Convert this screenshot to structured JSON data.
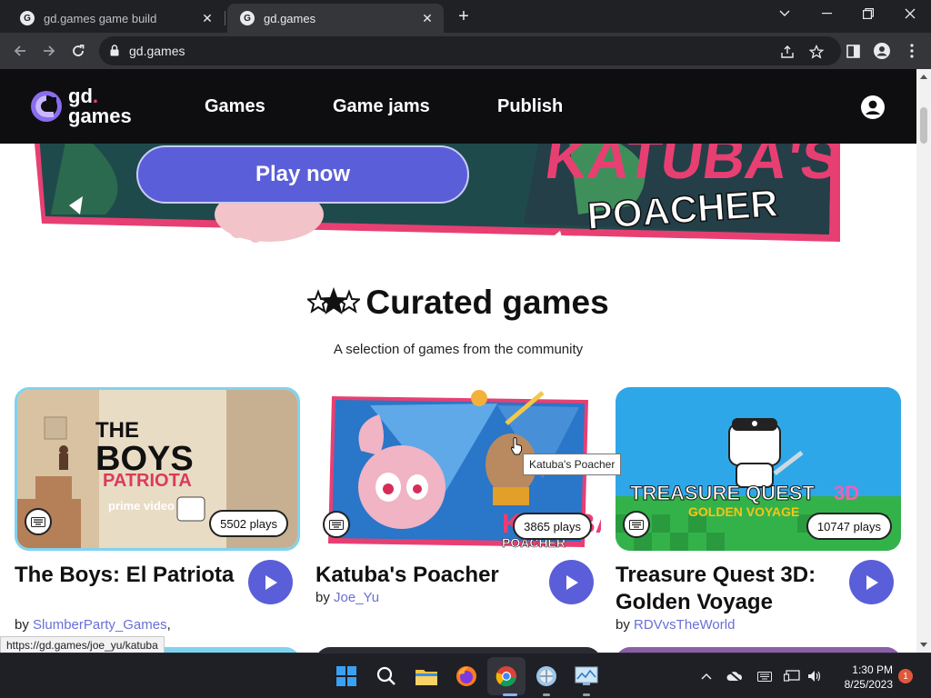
{
  "browser": {
    "tabs": [
      {
        "title": "gd.games game build",
        "active": false
      },
      {
        "title": "gd.games",
        "active": true
      }
    ],
    "url": "gd.games"
  },
  "site": {
    "logo_line1": "gd",
    "logo_dot": ".",
    "logo_line2": "games",
    "nav": [
      "Games",
      "Game jams",
      "Publish"
    ]
  },
  "hero": {
    "play_label": "Play now",
    "art_text_line1": "KATUBA'S",
    "art_text_line2": "POACHER"
  },
  "curated": {
    "title": "Curated games",
    "subtitle": "A selection of games from the community"
  },
  "games": [
    {
      "title": "The Boys: El Patriota",
      "by": "by",
      "author": "SlumberParty_Games",
      "author_suffix": ",",
      "plays": "5502 plays",
      "art_line1": "THE",
      "art_line2": "BOYS",
      "art_line3": "PATRIOTA",
      "art_line4": "prime video"
    },
    {
      "title": "Katuba's Poacher",
      "by": "by",
      "author": "Joe_Yu",
      "author_suffix": "",
      "plays": "3865 plays",
      "art_line1": "KATUBA'S",
      "art_line2": "POACHER"
    },
    {
      "title": "Treasure Quest 3D: Golden Voyage",
      "by": "by",
      "author": "RDVvsTheWorld",
      "author_suffix": "",
      "plays": "10747 plays",
      "art_line1": "TREASURE QUEST",
      "art_line2": "3D",
      "art_line3": "GOLDEN VOYAGE"
    }
  ],
  "tooltip": "Katuba's Poacher",
  "status_url": "https://gd.games/joe_yu/katuba",
  "taskbar": {
    "time": "1:30 PM",
    "date": "8/25/2023",
    "notification_count": "1"
  },
  "colors": {
    "accent": "#5a5ed8",
    "header_bg": "#0e0e10",
    "author_link": "#6a6fd6"
  }
}
